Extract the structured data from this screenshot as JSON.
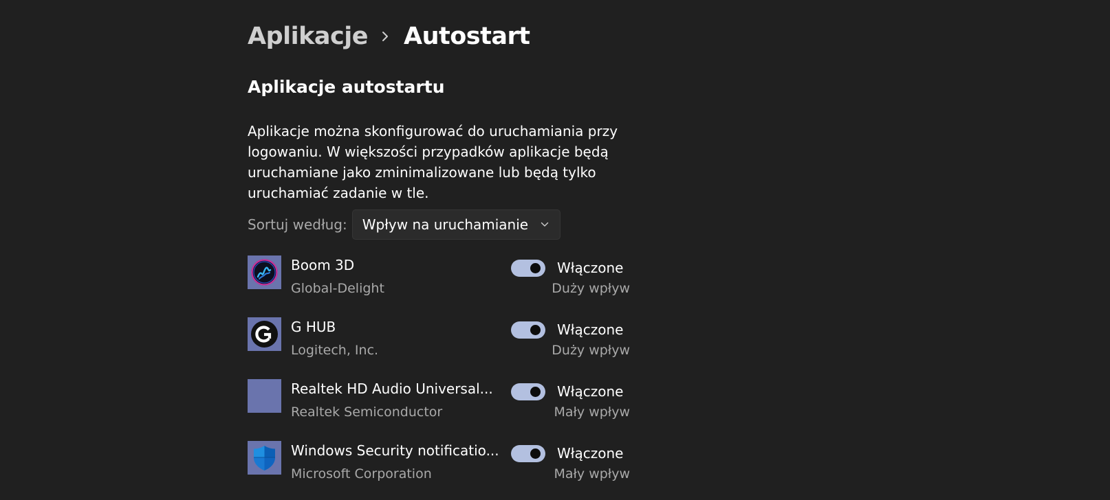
{
  "breadcrumb": {
    "parent": "Aplikacje",
    "current": "Autostart"
  },
  "section": {
    "title": "Aplikacje autostartu",
    "description_lines": [
      "Aplikacje można skonfigurować do uruchamiania przy",
      "logowaniu. W większości przypadków aplikacje będą",
      "uruchamiane jako zminimalizowane lub będą tylko",
      "uruchamiać zadanie w tle."
    ]
  },
  "sort": {
    "label": "Sortuj według:",
    "selected": "Wpływ na uruchamianie"
  },
  "apps": [
    {
      "name": "Boom 3D",
      "publisher": "Global-Delight",
      "status": "Włączone",
      "impact": "Duży wpływ",
      "enabled": true,
      "icon": "boom-3d-icon"
    },
    {
      "name": "G HUB",
      "publisher": "Logitech, Inc.",
      "status": "Włączone",
      "impact": "Duży wpływ",
      "enabled": true,
      "icon": "logitech-g-icon"
    },
    {
      "name": "Realtek HD Audio Universal...",
      "publisher": "Realtek Semiconductor",
      "status": "Włączone",
      "impact": "Mały wpływ",
      "enabled": true,
      "icon": "realtek-placeholder-icon"
    },
    {
      "name": "Windows Security notificatio...",
      "publisher": "Microsoft Corporation",
      "status": "Włączone",
      "impact": "Mały wpływ",
      "enabled": true,
      "icon": "windows-security-shield-icon"
    }
  ],
  "colors": {
    "background": "#202020",
    "toggle_on": "#b3c0e0",
    "icon_tile": "#6a74ad",
    "secondary_text": "#a9a9a9"
  }
}
